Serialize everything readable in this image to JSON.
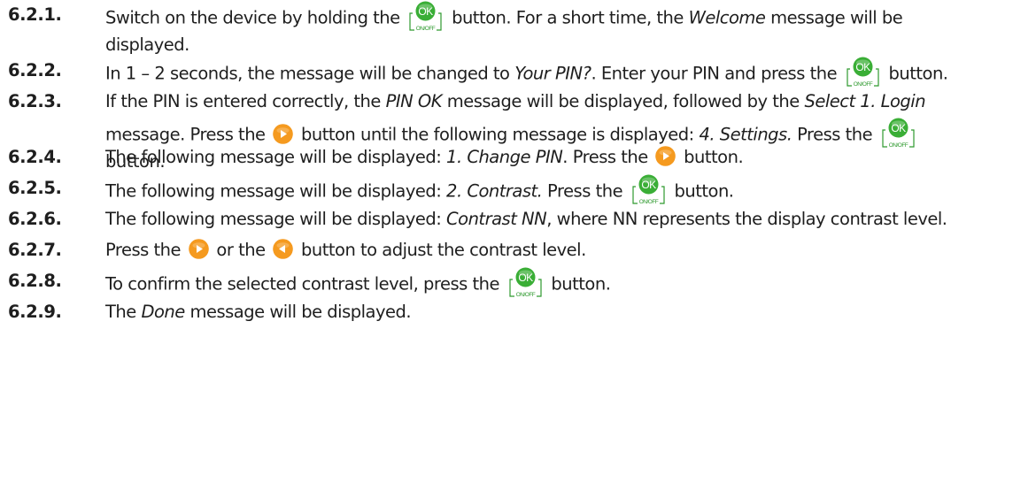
{
  "icons": {
    "ok": "ok-on-off-button-icon",
    "right": "right-arrow-button-icon",
    "left": "left-arrow-button-icon"
  },
  "colors": {
    "ok_green": "#3aae36",
    "ok_bracket": "#2f9a2f",
    "arrow_orange": "#f59a1f"
  },
  "ok_icon": {
    "label": "OK",
    "sublabel": "ON/OFF"
  },
  "steps": [
    {
      "number": "6.2.1.",
      "lines": [
        [
          {
            "t": "Switch on the device by holding the "
          },
          {
            "icon": "ok"
          },
          {
            "t": " button. For a short time, the "
          },
          {
            "i": "Welcome"
          },
          {
            "t": " message will be"
          }
        ],
        [
          {
            "t": "displayed."
          }
        ]
      ]
    },
    {
      "number": "6.2.2.",
      "lines": [
        [
          {
            "t": "In 1 – 2 seconds, the message will be changed to "
          },
          {
            "i": "Your PIN?"
          },
          {
            "t": ". Enter your PIN and press the "
          },
          {
            "icon": "ok"
          },
          {
            "t": " button."
          }
        ]
      ]
    },
    {
      "number": "6.2.3.",
      "lines": [
        [
          {
            "t": "If the PIN is entered correctly, the "
          },
          {
            "i": "PIN OK"
          },
          {
            "t": " message will be displayed, followed by the "
          },
          {
            "i": "Select 1. Login"
          }
        ],
        [
          {
            "t": "message. Press the "
          },
          {
            "icon": "right"
          },
          {
            "t": " button until the following message is displayed: "
          },
          {
            "i": "4. Settings."
          },
          {
            "t": " Press the "
          },
          {
            "icon": "ok"
          }
        ],
        [
          {
            "t": "button."
          }
        ]
      ]
    },
    {
      "number": "6.2.4.",
      "lines": [
        [
          {
            "t": "The following message will be displayed: "
          },
          {
            "i": "1. Change PIN"
          },
          {
            "t": ". Press the "
          },
          {
            "icon": "right"
          },
          {
            "t": " button."
          }
        ]
      ]
    },
    {
      "number": "6.2.5.",
      "lines": [
        [
          {
            "t": "The following message will be displayed: "
          },
          {
            "i": "2. Contrast."
          },
          {
            "t": " Press the "
          },
          {
            "icon": "ok"
          },
          {
            "t": " button."
          }
        ]
      ]
    },
    {
      "number": "6.2.6.",
      "lines": [
        [
          {
            "t": "The following message will be displayed: "
          },
          {
            "i": "Contrast NN"
          },
          {
            "t": ", where NN represents the display contrast level."
          }
        ]
      ]
    },
    {
      "number": "6.2.7.",
      "lines": [
        [
          {
            "t": "Press the "
          },
          {
            "icon": "right"
          },
          {
            "t": " or the "
          },
          {
            "icon": "left"
          },
          {
            "t": " button to adjust the contrast level."
          }
        ]
      ]
    },
    {
      "number": "6.2.8.",
      "lines": [
        [
          {
            "t": "To confirm the selected contrast level, press the "
          },
          {
            "icon": "ok"
          },
          {
            "t": " button."
          }
        ]
      ]
    },
    {
      "number": "6.2.9.",
      "lines": [
        [
          {
            "t": "The "
          },
          {
            "i": "Done"
          },
          {
            "t": " message will be displayed."
          }
        ]
      ]
    }
  ]
}
